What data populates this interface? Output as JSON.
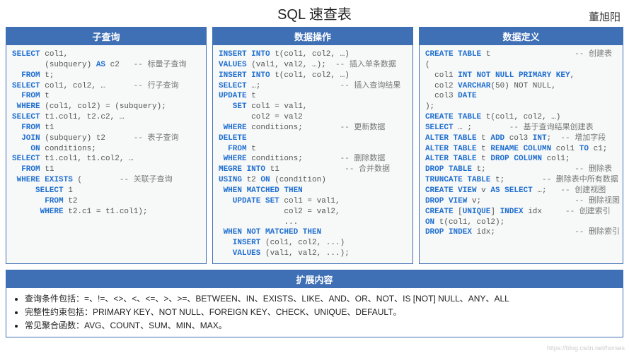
{
  "header": {
    "title": "SQL 速查表",
    "author": "董旭阳"
  },
  "panels": [
    {
      "title": "子查询",
      "lines": [
        [
          [
            "kw",
            "SELECT "
          ],
          [
            "",
            "col1,"
          ]
        ],
        [
          [
            "",
            "       (subquery) "
          ],
          [
            "kw",
            "AS"
          ],
          [
            "",
            " c2   "
          ],
          [
            "cm",
            "-- 标量子查询"
          ]
        ],
        [
          [
            "kw",
            "  FROM "
          ],
          [
            "",
            "t;"
          ]
        ],
        [
          [
            "",
            ""
          ]
        ],
        [
          [
            "kw",
            "SELECT "
          ],
          [
            "",
            "col1, col2, …      "
          ],
          [
            "cm",
            "-- 行子查询"
          ]
        ],
        [
          [
            "kw",
            "  FROM "
          ],
          [
            "",
            "t"
          ]
        ],
        [
          [
            "kw",
            " WHERE "
          ],
          [
            "",
            "(col1, col2) = (subquery);"
          ]
        ],
        [
          [
            "",
            ""
          ]
        ],
        [
          [
            "kw",
            "SELECT "
          ],
          [
            "",
            "t1.col1, t2.c2, …"
          ]
        ],
        [
          [
            "kw",
            "  FROM "
          ],
          [
            "",
            "t1"
          ]
        ],
        [
          [
            "kw",
            "  JOIN "
          ],
          [
            "",
            "(subquery) t2      "
          ],
          [
            "cm",
            "-- 表子查询"
          ]
        ],
        [
          [
            "kw",
            "    ON "
          ],
          [
            "",
            "conditions;"
          ]
        ],
        [
          [
            "",
            ""
          ]
        ],
        [
          [
            "kw",
            "SELECT "
          ],
          [
            "",
            "t1.col1, t1.col2, …"
          ]
        ],
        [
          [
            "kw",
            "  FROM "
          ],
          [
            "",
            "t1"
          ]
        ],
        [
          [
            "kw",
            " WHERE EXISTS "
          ],
          [
            "",
            "(        "
          ],
          [
            "cm",
            "-- 关联子查询"
          ]
        ],
        [
          [
            "kw",
            "     SELECT "
          ],
          [
            "",
            "1"
          ]
        ],
        [
          [
            "kw",
            "       FROM "
          ],
          [
            "",
            "t2"
          ]
        ],
        [
          [
            "kw",
            "      WHERE "
          ],
          [
            "",
            "t2.c1 = t1.col1);"
          ]
        ]
      ]
    },
    {
      "title": "数据操作",
      "lines": [
        [
          [
            "kw",
            "INSERT INTO "
          ],
          [
            "",
            "t(col1, col2, …)"
          ]
        ],
        [
          [
            "kw",
            "VALUES "
          ],
          [
            "",
            "(val1, val2, …);  "
          ],
          [
            "cm",
            "-- 插入单条数据"
          ]
        ],
        [
          [
            "",
            ""
          ]
        ],
        [
          [
            "kw",
            "INSERT INTO "
          ],
          [
            "",
            "t(col1, col2, …)"
          ]
        ],
        [
          [
            "kw",
            "SELECT "
          ],
          [
            "",
            "…;                 "
          ],
          [
            "cm",
            "-- 插入查询结果"
          ]
        ],
        [
          [
            "",
            ""
          ]
        ],
        [
          [
            "kw",
            "UPDATE "
          ],
          [
            "",
            "t"
          ]
        ],
        [
          [
            "kw",
            "   SET "
          ],
          [
            "",
            "col1 = val1,"
          ]
        ],
        [
          [
            "",
            "       col2 = val2"
          ]
        ],
        [
          [
            "kw",
            " WHERE "
          ],
          [
            "",
            "conditions;        "
          ],
          [
            "cm",
            "-- 更新数据"
          ]
        ],
        [
          [
            "",
            ""
          ]
        ],
        [
          [
            "kw",
            "DELETE"
          ]
        ],
        [
          [
            "kw",
            "  FROM "
          ],
          [
            "",
            "t"
          ]
        ],
        [
          [
            "kw",
            " WHERE "
          ],
          [
            "",
            "conditions;        "
          ],
          [
            "cm",
            "-- 删除数据"
          ]
        ],
        [
          [
            "",
            ""
          ]
        ],
        [
          [
            "kw",
            "MEGRE INTO "
          ],
          [
            "",
            "t1              "
          ],
          [
            "cm",
            "-- 合并数据"
          ]
        ],
        [
          [
            "kw",
            "USING "
          ],
          [
            "",
            "t2 "
          ],
          [
            "kw",
            "ON "
          ],
          [
            "",
            "(condition)"
          ]
        ],
        [
          [
            "kw",
            " WHEN MATCHED THEN"
          ]
        ],
        [
          [
            "kw",
            "   UPDATE SET "
          ],
          [
            "",
            "col1 = val1,"
          ]
        ],
        [
          [
            "",
            "              col2 = val2,"
          ]
        ],
        [
          [
            "",
            "              ..."
          ]
        ],
        [
          [
            "kw",
            " WHEN NOT MATCHED THEN"
          ]
        ],
        [
          [
            "kw",
            "   INSERT "
          ],
          [
            "",
            "(col1, col2, ...)"
          ]
        ],
        [
          [
            "kw",
            "   VALUES "
          ],
          [
            "",
            "(val1, val2, ...);"
          ]
        ]
      ]
    },
    {
      "title": "数据定义",
      "lines": [
        [
          [
            "kw",
            "CREATE TABLE "
          ],
          [
            "",
            "t                  "
          ],
          [
            "cm",
            "-- 创建表"
          ]
        ],
        [
          [
            "",
            "("
          ]
        ],
        [
          [
            "",
            "  col1 "
          ],
          [
            "kw",
            "INT NOT NULL PRIMARY KEY"
          ],
          [
            "",
            ","
          ]
        ],
        [
          [
            "",
            "  col2 "
          ],
          [
            "kw",
            "VARCHAR"
          ],
          [
            "",
            "(50) NOT NULL,"
          ]
        ],
        [
          [
            "",
            "  col3 "
          ],
          [
            "kw",
            "DATE"
          ]
        ],
        [
          [
            "",
            ");"
          ]
        ],
        [
          [
            "",
            ""
          ]
        ],
        [
          [
            "kw",
            "CREATE TABLE "
          ],
          [
            "",
            "t(col1, col2, …)"
          ]
        ],
        [
          [
            "kw",
            "SELECT "
          ],
          [
            "",
            "… ;        "
          ],
          [
            "cm",
            "-- 基于查询结果创建表"
          ]
        ],
        [
          [
            "",
            ""
          ]
        ],
        [
          [
            "kw",
            "ALTER TABLE "
          ],
          [
            "",
            "t "
          ],
          [
            "kw",
            "ADD "
          ],
          [
            "",
            "col3 "
          ],
          [
            "kw",
            "INT"
          ],
          [
            "",
            ";  "
          ],
          [
            "cm",
            "-- 增加字段"
          ]
        ],
        [
          [
            "kw",
            "ALTER TABLE "
          ],
          [
            "",
            "t "
          ],
          [
            "kw",
            "RENAME COLUMN "
          ],
          [
            "",
            "col1 "
          ],
          [
            "kw",
            "TO "
          ],
          [
            "",
            "c1;"
          ]
        ],
        [
          [
            "kw",
            "ALTER TABLE "
          ],
          [
            "",
            "t "
          ],
          [
            "kw",
            "DROP COLUMN "
          ],
          [
            "",
            "col1;"
          ]
        ],
        [
          [
            "",
            ""
          ]
        ],
        [
          [
            "kw",
            "DROP TABLE "
          ],
          [
            "",
            "t;                   "
          ],
          [
            "cm",
            "-- 删除表"
          ]
        ],
        [
          [
            "",
            ""
          ]
        ],
        [
          [
            "kw",
            "TRUNCATE TABLE "
          ],
          [
            "",
            "t;        "
          ],
          [
            "cm",
            "-- 删除表中所有数据"
          ]
        ],
        [
          [
            "",
            ""
          ]
        ],
        [
          [
            "kw",
            "CREATE VIEW "
          ],
          [
            "",
            "v "
          ],
          [
            "kw",
            "AS SELECT "
          ],
          [
            "",
            "…;   "
          ],
          [
            "cm",
            "-- 创建视图"
          ]
        ],
        [
          [
            "kw",
            "DROP VIEW "
          ],
          [
            "",
            "v;                    "
          ],
          [
            "cm",
            "-- 删除视图"
          ]
        ],
        [
          [
            "",
            ""
          ]
        ],
        [
          [
            "kw",
            "CREATE "
          ],
          [
            "",
            "["
          ],
          [
            "kw",
            "UNIQUE"
          ],
          [
            "",
            "] "
          ],
          [
            "kw",
            "INDEX "
          ],
          [
            "",
            "idx     "
          ],
          [
            "cm",
            "-- 创建索引"
          ]
        ],
        [
          [
            "kw",
            "ON "
          ],
          [
            "",
            "t(col1, col2);"
          ]
        ],
        [
          [
            "kw",
            "DROP INDEX "
          ],
          [
            "",
            "idx;                 "
          ],
          [
            "cm",
            "-- 删除索引"
          ]
        ]
      ]
    }
  ],
  "ext": {
    "title": "扩展内容",
    "items": [
      "查询条件包括：=、!=、<>、<、<=、>、>=、BETWEEN、IN、EXISTS、LIKE、AND、OR、NOT、IS [NOT] NULL、ANY、ALL",
      "完整性约束包括：PRIMARY KEY、NOT NULL、FOREIGN KEY、CHECK、UNIQUE、DEFAULT。",
      "常见聚合函数：AVG、COUNT、SUM、MIN、MAX。"
    ]
  },
  "watermark": "https://blog.csdn.net/horses"
}
